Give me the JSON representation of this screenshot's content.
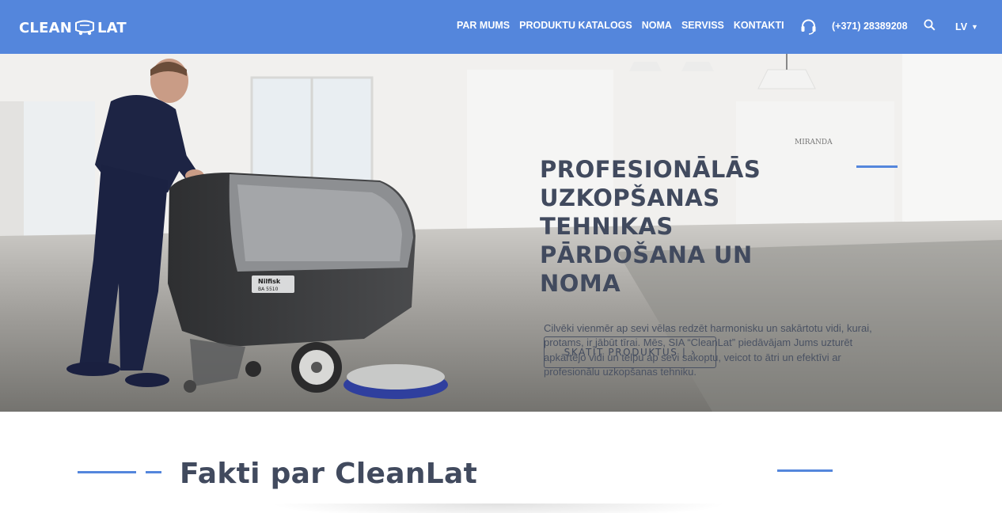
{
  "header": {
    "logo_part1": "CLEAN",
    "logo_part2": "LAT",
    "nav": [
      {
        "label": "PAR MUMS"
      },
      {
        "label": "PRODUKTU KATALOGS"
      },
      {
        "label": "NOMA"
      },
      {
        "label": "SERVISS"
      },
      {
        "label": "KONTAKTI"
      }
    ],
    "phone": "(+371) 28389208",
    "language": "LV",
    "icons": {
      "support": "headset-icon",
      "search": "search-icon",
      "language_caret": "caret-down-icon"
    },
    "background_color": "#5486dc"
  },
  "hero": {
    "title": "PROFESIONĀLĀS UZKOPŠANAS TEHNIKAS PĀRDOŠANA UN NOMA",
    "text": "Cilvēki vienmēr ap sevi vēlas redzēt harmonisku un sakārtotu vidi, kurai, protams, ir jābūt tīrai. Mēs, SIA “CleanLat” piedāvājam Jums uzturēt apkārtējo vidi un telpu ap sevi sakoptu, veicot to ātri un efektīvi ar profesionālu uzkopšanas tehniku.",
    "button_label": "SKATĪT PRODUKTUS | ›",
    "machine_brand": "Nilfisk",
    "machine_model": "BA 5510",
    "wall_sign": "MIRANDA"
  },
  "facts": {
    "title": "Fakti par CleanLat"
  },
  "colors": {
    "accent": "#5486dc",
    "heading": "#414a5e"
  }
}
